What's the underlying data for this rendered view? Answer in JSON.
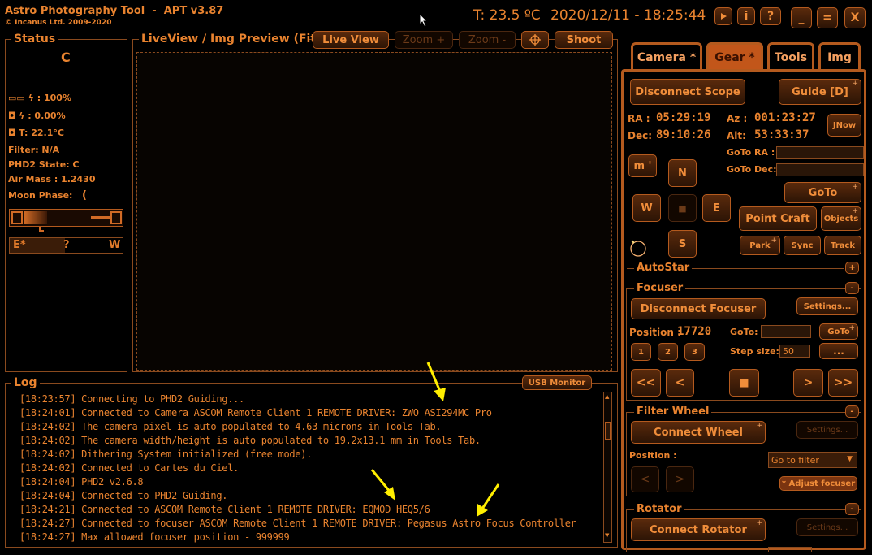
{
  "app": {
    "title": "Astro Photography Tool",
    "version": "APT v3.87",
    "copyright": "© Incanus Ltd. 2009-2020",
    "temperature": "T: 23.5 ºC",
    "datetime": "2020/12/11 - 18:25:44",
    "window_buttons": [
      "_",
      "=",
      "X"
    ]
  },
  "status": {
    "title": "Status",
    "state_letter": "C",
    "power_1": ": 100%",
    "power_2": ": 0.00%",
    "camera_temp": "T: 22.1°C",
    "filter": "Filter: N/A",
    "phd2_state": "PHD2 State: C",
    "air_mass": "Air Mass : 1.2430",
    "moon_phase": "Moon Phase:",
    "moon_glyph": "(",
    "meridian_left": "E*",
    "meridian_mid": "?",
    "meridian_right": "W"
  },
  "liveview": {
    "title": "LiveView / Img Preview (Fit)",
    "live_view": "Live View",
    "zoom_in": "Zoom +",
    "zoom_out": "Zoom -",
    "shoot": "Shoot"
  },
  "log": {
    "title": "Log",
    "usb_monitor": "USB Monitor",
    "lines": [
      "[18:23:57] Connecting to PHD2 Guiding...",
      "[18:24:01] Connected to Camera ASCOM Remote Client 1 REMOTE DRIVER: ZWO ASI294MC Pro",
      "[18:24:02] The camera pixel is auto populated to 4.63 microns in Tools Tab.",
      "[18:24:02] The camera width/height is auto populated to 19.2x13.1 mm in Tools Tab.",
      "[18:24:02] Dithering System initialized (free mode).",
      "[18:24:02] Connected to Cartes du Ciel.",
      "[18:24:04] PHD2 v2.6.8",
      "[18:24:04] Connected to PHD2 Guiding.",
      "[18:24:21] Connected to ASCOM Remote Client 1 REMOTE DRIVER: EQMOD HEQ5/6",
      "[18:24:27] Connected to focuser ASCOM Remote Client 1 REMOTE DRIVER: Pegasus Astro Focus Controller",
      "[18:24:27] Max allowed focuser position -  999999"
    ]
  },
  "tabs": [
    "Camera *",
    "Gear *",
    "Tools",
    "Img"
  ],
  "gear": {
    "disconnect_scope": "Disconnect Scope",
    "guide": "Guide [D]",
    "ra_label": "RA :",
    "ra_value": "05:29:19",
    "dec_label": "Dec:",
    "dec_value": "89:10:26",
    "az_label": "Az :",
    "az_value": "001:23:27",
    "alt_label": "Alt:",
    "alt_value": "53:33:37",
    "jnow": "JNow",
    "m_prime": "m '",
    "goto_ra": "GoTo RA :",
    "goto_dec": "GoTo Dec:",
    "north": "N",
    "west": "W",
    "east": "E",
    "south": "S",
    "stop_glyph": "■",
    "goto": "GoTo",
    "point_craft": "Point Craft",
    "objects": "Objects",
    "park": "Park",
    "sync": "Sync",
    "track": "Track",
    "autostar": "AutoStar"
  },
  "focuser": {
    "title": "Focuser",
    "disconnect": "Disconnect Focuser",
    "settings": "Settings...",
    "position_label": "Position :",
    "position_value": "17720",
    "goto_label": "GoTo:",
    "goto_button": "GoTo",
    "presets": [
      "1",
      "2",
      "3"
    ],
    "step_label": "Step size:",
    "step_value": "50",
    "more": "...",
    "move_buttons": [
      "<<",
      "<",
      "■",
      ">",
      ">>"
    ]
  },
  "filter_wheel": {
    "title": "Filter Wheel",
    "connect": "Connect Wheel",
    "settings": "Settings...",
    "position_label": "Position :",
    "goto_filter": "Go to filter",
    "prev": "<",
    "next": ">",
    "adjust_focuser": "* Adjust focuser"
  },
  "rotator": {
    "title": "Rotator",
    "connect": "Connect Rotator",
    "settings": "Settings..."
  },
  "colors": {
    "accent": "#e9832f",
    "border": "#b45a1e",
    "active_tab": "#c2561a",
    "arrow": "#ffee00"
  }
}
